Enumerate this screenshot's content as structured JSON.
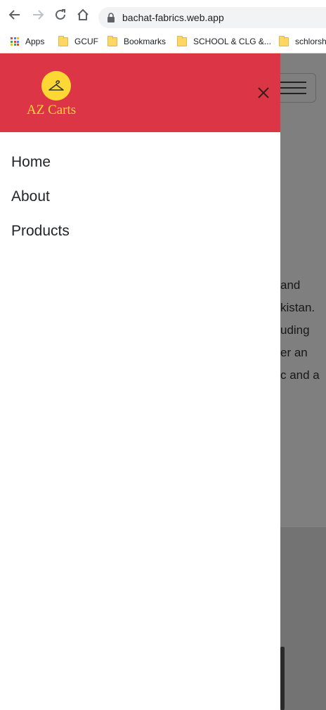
{
  "browser": {
    "url": "bachat-fabrics.web.app",
    "bookmarks": [
      {
        "label": "Apps",
        "icon": "apps-grid-icon"
      },
      {
        "label": "GCUF",
        "icon": "folder-icon"
      },
      {
        "label": "Bookmarks",
        "icon": "folder-icon"
      },
      {
        "label": "SCHOOL & CLG &...",
        "icon": "folder-icon"
      },
      {
        "label": "schlorshi",
        "icon": "folder-icon"
      }
    ]
  },
  "page": {
    "paragraph_fragments": [
      "and",
      "kistan.",
      "uding",
      "er an",
      "c and a"
    ]
  },
  "drawer": {
    "brand": "AZ Carts",
    "brand_color": "#fdd835",
    "header_color": "#dc3545",
    "logo_icon": "hanger-icon",
    "nav": [
      {
        "label": "Home"
      },
      {
        "label": "About"
      },
      {
        "label": "Products"
      }
    ]
  }
}
